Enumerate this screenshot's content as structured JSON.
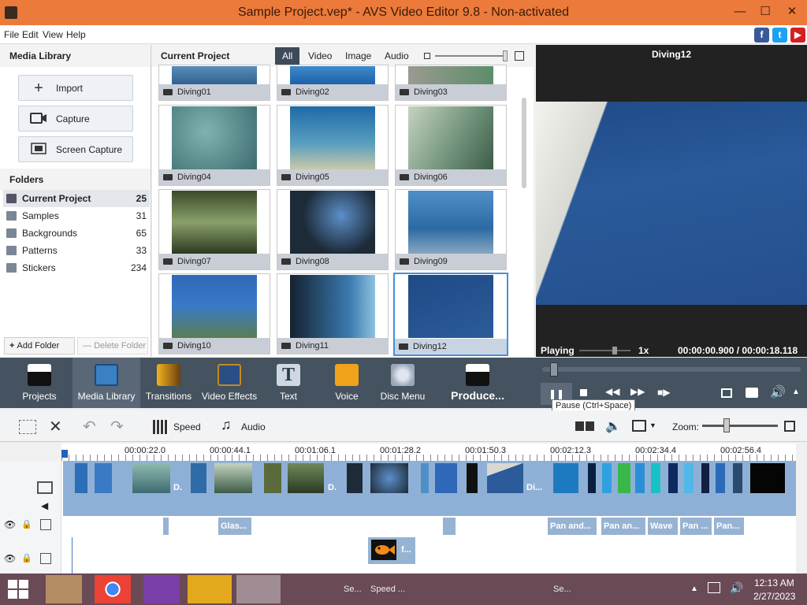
{
  "window": {
    "title": "Sample Project.vep* - AVS Video Editor 9.8 - Non-activated",
    "minimize": "—",
    "maximize": "☐",
    "close": "✕"
  },
  "menu": [
    "File",
    "Edit",
    "View",
    "Help"
  ],
  "social": [
    "f",
    "t",
    "▶"
  ],
  "media_library": {
    "title": "Media Library",
    "buttons": [
      "Import",
      "Capture",
      "Screen Capture"
    ],
    "folders_title": "Folders",
    "folders": [
      {
        "name": "Current Project",
        "count": "25"
      },
      {
        "name": "Samples",
        "count": "31"
      },
      {
        "name": "Backgrounds",
        "count": "65"
      },
      {
        "name": "Patterns",
        "count": "33"
      },
      {
        "name": "Stickers",
        "count": "234"
      }
    ],
    "add_folder": "Add Folder",
    "delete_folder": "Delete Folder"
  },
  "project": {
    "title": "Current Project",
    "filters": [
      "All",
      "Video",
      "Image",
      "Audio"
    ],
    "items": [
      "Diving01",
      "Diving02",
      "Diving03",
      "Diving04",
      "Diving05",
      "Diving06",
      "Diving07",
      "Diving08",
      "Diving09",
      "Diving10",
      "Diving11",
      "Diving12"
    ]
  },
  "preview": {
    "title": "Diving12",
    "status": "Playing",
    "speed": "1x",
    "time": "00:00:00.900 / 00:00:18.118"
  },
  "toolbar": [
    "Projects",
    "Media Library",
    "Transitions",
    "Video Effects",
    "Text",
    "Voice",
    "Disc Menu",
    "Produce..."
  ],
  "tooltip": "Pause (Ctrl+Space)",
  "timeline": {
    "speed": "Speed",
    "audio": "Audio",
    "zoom": "Zoom:",
    "ticks": [
      "00:00:22.0",
      "00:01:06.1",
      "00:02:12.3",
      "00:02:34.4",
      "00:02:56.4"
    ],
    "ticks_odd": [
      "00:00:44.1",
      "00:01:28.2",
      "00:01:50.3"
    ],
    "clip_labels": [
      "D.",
      "D.",
      "Di..."
    ],
    "effects": [
      "Glas...",
      "Pan and...",
      "Pan an...",
      "Wave",
      "Pan ...",
      "Pan..."
    ],
    "text_clip": "f...",
    "bottom": [
      "Se...",
      "Speed ...",
      "Se..."
    ]
  },
  "clock": {
    "time": "12:13 AM",
    "date": "2/27/2023"
  }
}
